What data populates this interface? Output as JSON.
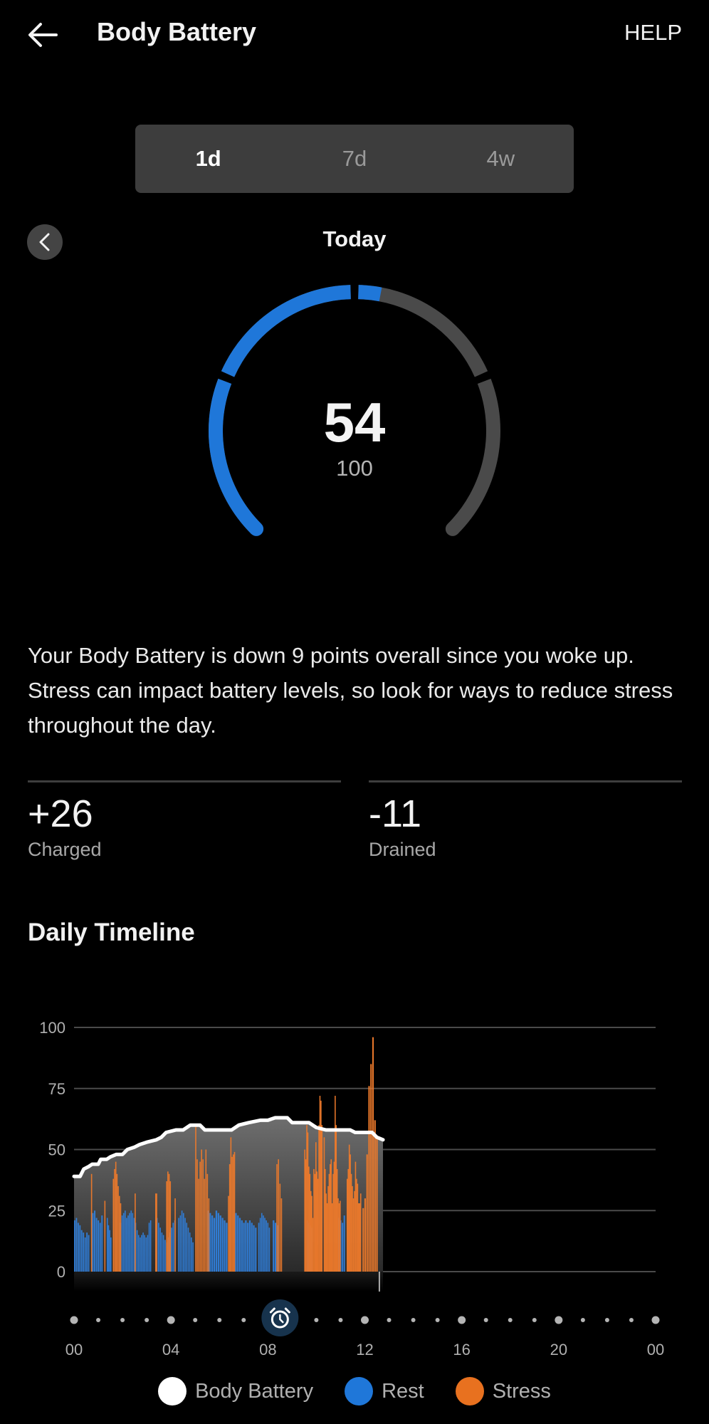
{
  "header": {
    "back_icon": "arrow-left-icon",
    "title": "Body Battery",
    "help_label": "HELP"
  },
  "range_tabs": [
    {
      "label": "1d",
      "active": true
    },
    {
      "label": "7d",
      "active": false
    },
    {
      "label": "4w",
      "active": false
    }
  ],
  "day_nav": {
    "prev_icon": "chevron-left-icon",
    "label": "Today"
  },
  "gauge": {
    "value": "54",
    "max": "100",
    "value_num": 54,
    "max_num": 100,
    "fill_color": "#1f77d9",
    "track_color": "#4a4a4a"
  },
  "summary": {
    "text": "Your Body Battery is down 9 points overall since you woke up. Stress can impact battery levels, so look for ways to reduce stress throughout the day."
  },
  "stats": [
    {
      "value": "+26",
      "label": "Charged"
    },
    {
      "value": "-11",
      "label": "Drained"
    }
  ],
  "timeline": {
    "title": "Daily Timeline",
    "wake_icon": "alarm-clock-icon",
    "wake_hour": 8.5
  },
  "legend": [
    {
      "label": "Body Battery",
      "color": "#ffffff"
    },
    {
      "label": "Rest",
      "color": "#1f77d9"
    },
    {
      "label": "Stress",
      "color": "#e8711f"
    }
  ],
  "chart_data": {
    "type": "bar",
    "title": "Daily Timeline",
    "xlabel": "",
    "ylabel": "",
    "ylim": [
      0,
      100
    ],
    "xlim_hours": [
      0,
      24
    ],
    "grid": true,
    "legend_position": "bottom-center",
    "y_ticks": [
      "0",
      "25",
      "50",
      "75",
      "100"
    ],
    "x_ticks": [
      "00",
      "04",
      "08",
      "12",
      "16",
      "20",
      "00"
    ],
    "x_tick_hours": [
      0,
      4,
      8,
      12,
      16,
      20,
      24
    ],
    "current_hour": 12.6,
    "colors": {
      "body_battery": "#ffffff",
      "rest": "#2f80dc",
      "stress": "#ee7a2b",
      "area_top": "#6e6e6e",
      "area_bottom": "#2a2a2a"
    },
    "body_battery_line": {
      "name": "Body Battery",
      "points": [
        [
          0.0,
          39
        ],
        [
          0.25,
          39
        ],
        [
          0.4,
          42
        ],
        [
          0.6,
          43
        ],
        [
          0.75,
          44
        ],
        [
          1.0,
          44
        ],
        [
          1.1,
          46
        ],
        [
          1.35,
          46
        ],
        [
          1.5,
          47
        ],
        [
          1.75,
          48
        ],
        [
          2.0,
          48
        ],
        [
          2.2,
          50
        ],
        [
          2.5,
          51
        ],
        [
          2.7,
          52
        ],
        [
          3.0,
          53
        ],
        [
          3.4,
          54
        ],
        [
          3.6,
          55
        ],
        [
          3.8,
          57
        ],
        [
          4.2,
          58
        ],
        [
          4.5,
          58
        ],
        [
          4.8,
          60
        ],
        [
          5.2,
          60
        ],
        [
          5.4,
          58
        ],
        [
          6.5,
          58
        ],
        [
          6.8,
          60
        ],
        [
          7.2,
          61
        ],
        [
          7.7,
          62
        ],
        [
          8.0,
          62
        ],
        [
          8.3,
          63
        ],
        [
          8.8,
          63
        ],
        [
          9.0,
          61
        ],
        [
          9.7,
          61
        ],
        [
          10.0,
          59
        ],
        [
          10.4,
          58
        ],
        [
          11.4,
          58
        ],
        [
          11.6,
          57
        ],
        [
          12.3,
          57
        ],
        [
          12.5,
          55
        ],
        [
          12.75,
          54
        ]
      ]
    },
    "series": [
      {
        "name": "Rest",
        "segments": [
          {
            "start": 0.0,
            "end": 0.65,
            "values": [
              21,
              22,
              20,
              19,
              17,
              16,
              14,
              16,
              15
            ]
          },
          {
            "start": 0.75,
            "end": 1.2,
            "values": [
              24,
              25,
              22,
              21,
              20,
              23
            ]
          },
          {
            "start": 1.35,
            "end": 1.55,
            "values": [
              22,
              19,
              17,
              14
            ]
          },
          {
            "start": 1.9,
            "end": 3.2,
            "values": [
              20,
              23,
              24,
              25,
              22,
              23,
              24,
              25,
              24,
              22,
              20,
              17,
              15,
              14,
              15,
              16,
              15,
              14,
              15,
              20,
              21
            ]
          },
          {
            "start": 3.4,
            "end": 4.2,
            "values": [
              22,
              20,
              18,
              16,
              15,
              13,
              12,
              14,
              16,
              18,
              20,
              21
            ]
          },
          {
            "start": 4.3,
            "end": 4.95,
            "values": [
              22,
              23,
              25,
              24,
              22,
              20,
              18,
              16,
              14,
              12
            ]
          },
          {
            "start": 5.5,
            "end": 6.35,
            "values": [
              25,
              24,
              23,
              22,
              25,
              24,
              23,
              22,
              21,
              20
            ]
          },
          {
            "start": 6.65,
            "end": 7.55,
            "values": [
              24,
              23,
              22,
              21,
              20,
              21,
              20,
              21,
              20,
              19,
              18
            ]
          },
          {
            "start": 7.6,
            "end": 8.1,
            "values": [
              20,
              22,
              24,
              23,
              22,
              21,
              20,
              18
            ]
          },
          {
            "start": 8.2,
            "end": 8.45,
            "values": [
              21,
              20,
              19
            ]
          },
          {
            "start": 9.6,
            "end": 9.85,
            "values": [
              21,
              20,
              19,
              18
            ]
          },
          {
            "start": 10.9,
            "end": 11.2,
            "values": [
              22,
              21,
              20,
              23
            ]
          }
        ]
      },
      {
        "name": "Stress",
        "segments": [
          {
            "start": 0.7,
            "end": 0.72,
            "values": [
              40
            ]
          },
          {
            "start": 1.25,
            "end": 1.3,
            "values": [
              29
            ]
          },
          {
            "start": 1.6,
            "end": 1.95,
            "values": [
              38,
              42,
              45,
              40,
              35,
              31,
              28
            ]
          },
          {
            "start": 3.35,
            "end": 3.45,
            "values": [
              32
            ]
          },
          {
            "start": 2.5,
            "end": 2.52,
            "values": [
              32
            ]
          },
          {
            "start": 3.8,
            "end": 4.0,
            "values": [
              37,
              41,
              40,
              37
            ]
          },
          {
            "start": 4.15,
            "end": 4.17,
            "values": [
              30
            ]
          },
          {
            "start": 5.0,
            "end": 5.6,
            "values": [
              60,
              46,
              38,
              45,
              50,
              46,
              38,
              50,
              40,
              30
            ]
          },
          {
            "start": 6.35,
            "end": 6.65,
            "values": [
              31,
              44,
              55,
              47,
              48,
              49
            ]
          },
          {
            "start": 8.35,
            "end": 8.6,
            "values": [
              44,
              46,
              36,
              30
            ]
          },
          {
            "start": 9.5,
            "end": 10.25,
            "values": [
              50,
              46,
              60,
              57,
              43,
              40,
              33,
              31,
              22,
              42,
              40,
              53,
              41,
              38,
              60,
              72,
              70,
              60
            ]
          },
          {
            "start": 10.3,
            "end": 11.0,
            "values": [
              55,
              42,
              32,
              28,
              35,
              40,
              44,
              46,
              28,
              40,
              45,
              72,
              60,
              42,
              30,
              28,
              29
            ]
          },
          {
            "start": 11.25,
            "end": 11.85,
            "values": [
              38,
              42,
              52,
              48,
              40,
              35,
              30,
              33,
              45,
              38,
              36,
              28,
              28,
              32
            ]
          },
          {
            "start": 11.9,
            "end": 12.55,
            "values": [
              26,
              30,
              48,
              76,
              85,
              96,
              62,
              55
            ]
          }
        ]
      }
    ]
  }
}
